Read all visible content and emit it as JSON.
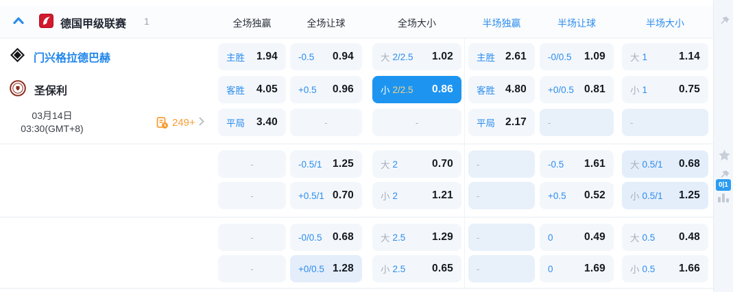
{
  "league_header": {
    "name": "德国甲级联赛",
    "match_count": "1",
    "columns": [
      {
        "label": "全场独赢",
        "scope": "full"
      },
      {
        "label": "全场让球",
        "scope": "full"
      },
      {
        "label": "全场大小",
        "scope": "full"
      },
      {
        "label": "半场独赢",
        "scope": "half"
      },
      {
        "label": "半场让球",
        "scope": "half"
      },
      {
        "label": "半场大小",
        "scope": "half"
      }
    ]
  },
  "match": {
    "home_team": "门兴格拉德巴赫",
    "away_team": "圣保利",
    "date": "03月14日",
    "time": "03:30(GMT+8)",
    "extra_markets": "249+"
  },
  "odds": {
    "row_groups": [
      [
        [
          {
            "label": "主胜",
            "value": "1.94"
          },
          {
            "label": "-0.5",
            "value": "0.94"
          },
          {
            "prefix": "大",
            "label": "2/2.5",
            "value": "1.02"
          },
          {
            "label": "主胜",
            "value": "2.61"
          },
          {
            "label": "-0/0.5",
            "value": "1.09"
          },
          {
            "prefix": "大",
            "label": "1",
            "value": "1.14"
          }
        ],
        [
          {
            "label": "客胜",
            "value": "4.05"
          },
          {
            "label": "+0.5",
            "value": "0.96"
          },
          {
            "prefix": "小",
            "label": "2/2.5",
            "value": "0.86",
            "state": "highlight"
          },
          {
            "label": "客胜",
            "value": "4.80"
          },
          {
            "label": "+0/0.5",
            "value": "0.81"
          },
          {
            "prefix": "小",
            "label": "1",
            "value": "0.75"
          }
        ],
        [
          {
            "label": "平局",
            "value": "3.40"
          },
          {
            "value": "-",
            "state": "empty"
          },
          {
            "value": "-",
            "state": "empty"
          },
          {
            "label": "平局",
            "value": "2.17"
          },
          {
            "value": "-",
            "state": "empty-tint"
          },
          {
            "value": "-",
            "state": "empty-tint"
          }
        ]
      ],
      [
        [
          {
            "value": "-",
            "state": "empty"
          },
          {
            "label": "-0.5/1",
            "value": "1.25"
          },
          {
            "prefix": "大",
            "label": "2",
            "value": "0.70"
          },
          {
            "value": "-",
            "state": "empty-tint"
          },
          {
            "label": "-0.5",
            "value": "1.61"
          },
          {
            "prefix": "大",
            "label": "0.5/1",
            "value": "0.68",
            "state": "tint"
          }
        ],
        [
          {
            "value": "-",
            "state": "empty"
          },
          {
            "label": "+0.5/1",
            "value": "0.70"
          },
          {
            "prefix": "小",
            "label": "2",
            "value": "1.21"
          },
          {
            "value": "-",
            "state": "empty-tint"
          },
          {
            "label": "+0.5",
            "value": "0.52"
          },
          {
            "prefix": "小",
            "label": "0.5/1",
            "value": "1.25",
            "state": "tint"
          }
        ]
      ],
      [
        [
          {
            "value": "-",
            "state": "empty"
          },
          {
            "label": "-0/0.5",
            "value": "0.68"
          },
          {
            "prefix": "大",
            "label": "2.5",
            "value": "1.29"
          },
          {
            "value": "-",
            "state": "empty-tint"
          },
          {
            "label": "0",
            "value": "0.49"
          },
          {
            "prefix": "大",
            "label": "0.5",
            "value": "0.48"
          }
        ],
        [
          {
            "value": "-",
            "state": "empty"
          },
          {
            "label": "+0/0.5",
            "value": "1.28",
            "state": "tint"
          },
          {
            "prefix": "小",
            "label": "2.5",
            "value": "0.65"
          },
          {
            "value": "-",
            "state": "empty-tint"
          },
          {
            "label": "0",
            "value": "1.69"
          },
          {
            "prefix": "小",
            "label": "0.5",
            "value": "1.66"
          }
        ]
      ]
    ]
  },
  "right_rail": {
    "score_badge": "0|1"
  },
  "colors": {
    "accent_blue": "#2b8ced",
    "highlight_cell": "#1d95f0",
    "highlight_gold": "#f2d387",
    "orange": "#f79d33",
    "cell_bg": "#f3f7fc",
    "cell_bg_tint": "#e8f1fa"
  }
}
